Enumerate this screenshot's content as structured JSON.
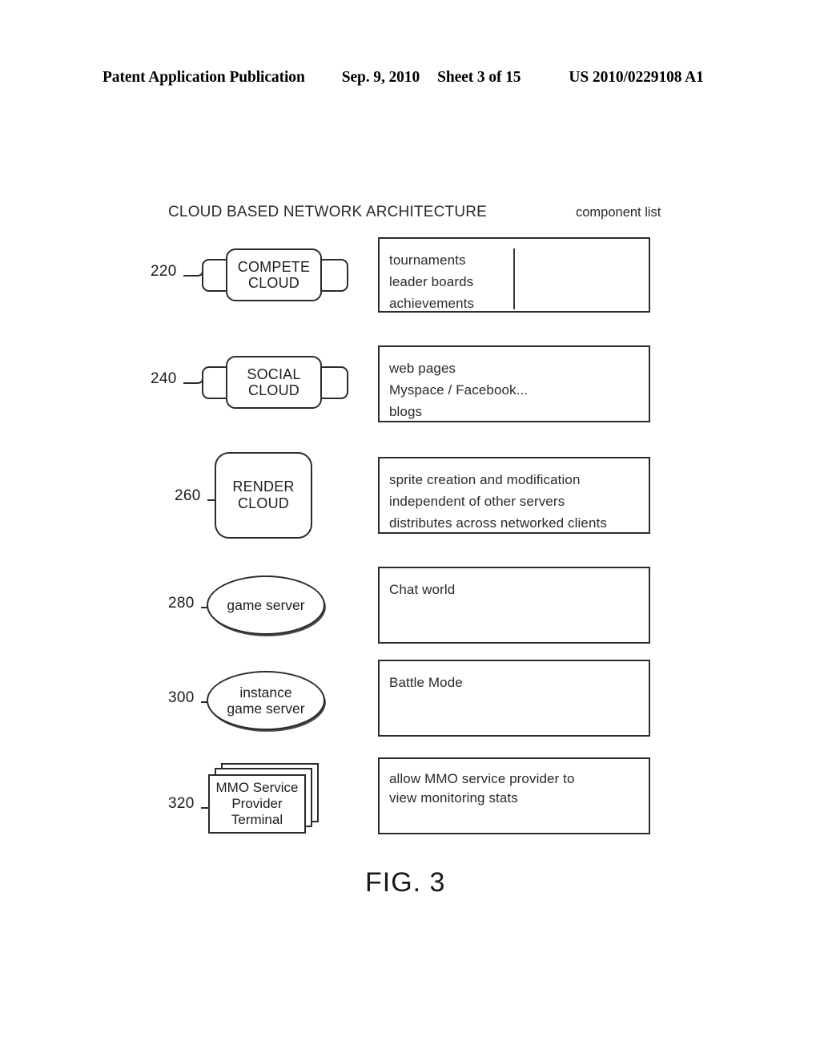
{
  "header": {
    "publication": "Patent Application Publication",
    "date": "Sep. 9, 2010",
    "sheet": "Sheet 3 of 15",
    "patent_number": "US 2010/0229108 A1"
  },
  "figure": {
    "title": "CLOUD BASED NETWORK ARCHITECTURE",
    "column_header": "component list",
    "caption": "FIG. 3",
    "rows": [
      {
        "ref": "220",
        "shape": "cloud",
        "label_line1": "COMPETE",
        "label_line2": "CLOUD",
        "components": [
          "tournaments",
          "leader boards",
          "achievements"
        ],
        "has_divider": true
      },
      {
        "ref": "240",
        "shape": "cloud",
        "label_line1": "SOCIAL",
        "label_line2": "CLOUD",
        "components": [
          "web pages",
          "Myspace / Facebook...",
          "blogs"
        ],
        "has_divider": false
      },
      {
        "ref": "260",
        "shape": "rounded-rect",
        "label_line1": "RENDER",
        "label_line2": "CLOUD",
        "components": [
          "sprite creation and modification",
          "independent of other servers",
          "distributes across networked clients"
        ],
        "has_divider": false
      },
      {
        "ref": "280",
        "shape": "ellipse",
        "label_line1": "game server",
        "label_line2": "",
        "components": [
          "Chat world"
        ],
        "has_divider": false
      },
      {
        "ref": "300",
        "shape": "ellipse",
        "label_line1": "instance",
        "label_line2": "game server",
        "components": [
          "Battle Mode"
        ],
        "has_divider": false
      },
      {
        "ref": "320",
        "shape": "stacked-rect",
        "label_line1": "MMO Service",
        "label_line2": "Provider",
        "label_line3": "Terminal",
        "components": [
          "allow MMO service provider to",
          "view monitoring stats"
        ],
        "has_divider": false
      }
    ]
  },
  "colors": {
    "ink": "#1a1a1a",
    "line": "#2b2b2b",
    "background": "#ffffff"
  }
}
